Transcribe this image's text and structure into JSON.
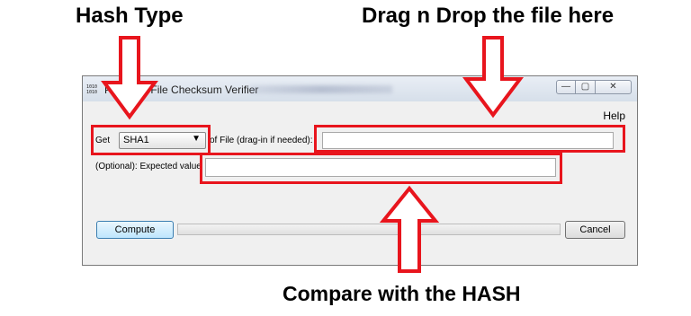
{
  "annotations": {
    "hash_type": "Hash Type",
    "drag_drop": "Drag n Drop the file here",
    "compare": "Compare with the HASH"
  },
  "window": {
    "icon_text": [
      "1010",
      "1010"
    ],
    "title": "Ponterac File Checksum Verifier",
    "controls": {
      "minimize": "—",
      "maximize": "▢",
      "close": "✕"
    }
  },
  "menu": {
    "help": "Help"
  },
  "form": {
    "get_label": "Get",
    "hash_select": {
      "value": "SHA1"
    },
    "file_label": "of File (drag-in if needed):",
    "file_input": {
      "value": ""
    },
    "expected_label": "(Optional): Expected value",
    "expected_input": {
      "value": ""
    }
  },
  "actions": {
    "compute": "Compute",
    "cancel": "Cancel",
    "progress_percent": 0
  },
  "colors": {
    "highlight": "#e8151d",
    "progress_fill": "#06b025"
  }
}
